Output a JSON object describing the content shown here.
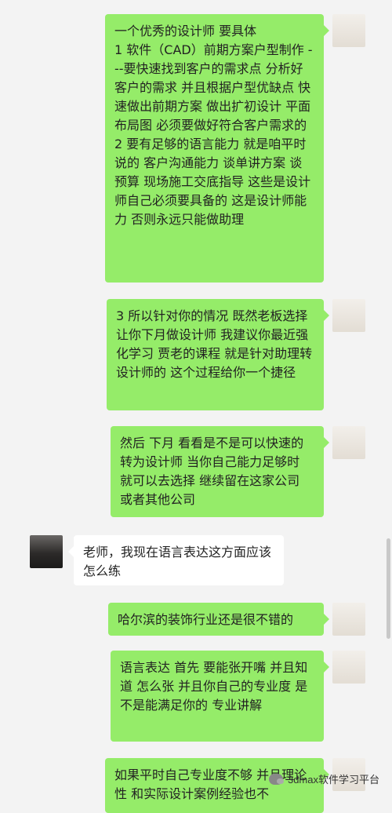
{
  "messages": [
    {
      "side": "right",
      "text": "一个优秀的设计师 要具体\n1 软件（CAD）前期方案户型制作 ---要快速找到客户的需求点 分析好客户的需求 并且根据户型优缺点 快速做出前期方案 做出扩初设计 平面布局图 必须要做好符合客户需求的\n2 要有足够的语言能力 就是咱平时说的 客户沟通能力 谈单讲方案 谈预算 现场施工交底指导 这些是设计师自己必须要具备的 这是设计师能力 否则永远只能做助理"
    },
    {
      "side": "right",
      "text": "3 所以针对你的情况 既然老板选择让你下月做设计师 我建议你最近强化学习 贾老的课程 就是针对助理转设计师的 这个过程给你一个捷径"
    },
    {
      "side": "right",
      "text": "然后 下月 看看是不是可以快速的转为设计师 当你自己能力足够时 就可以去选择 继续留在这家公司 或者其他公司"
    },
    {
      "side": "left",
      "text": "老师，我现在语言表达这方面应该怎么练"
    },
    {
      "side": "right",
      "text": "哈尔滨的装饰行业还是很不错的"
    },
    {
      "side": "right",
      "text": "语言表达 首先 要能张开嘴 并且知道 怎么张 并且你自己的专业度 是不是能满足你的 专业讲解"
    },
    {
      "side": "right",
      "text": "如果平时自己专业度不够 并且理论性 和实际设计案例经验也不"
    }
  ],
  "watermark": {
    "text": "3dmax软件学习平台",
    "icon": "wechat-icon"
  },
  "colors": {
    "background": "#f3f3f3",
    "own_bubble": "#95ec69",
    "other_bubble": "#ffffff"
  }
}
